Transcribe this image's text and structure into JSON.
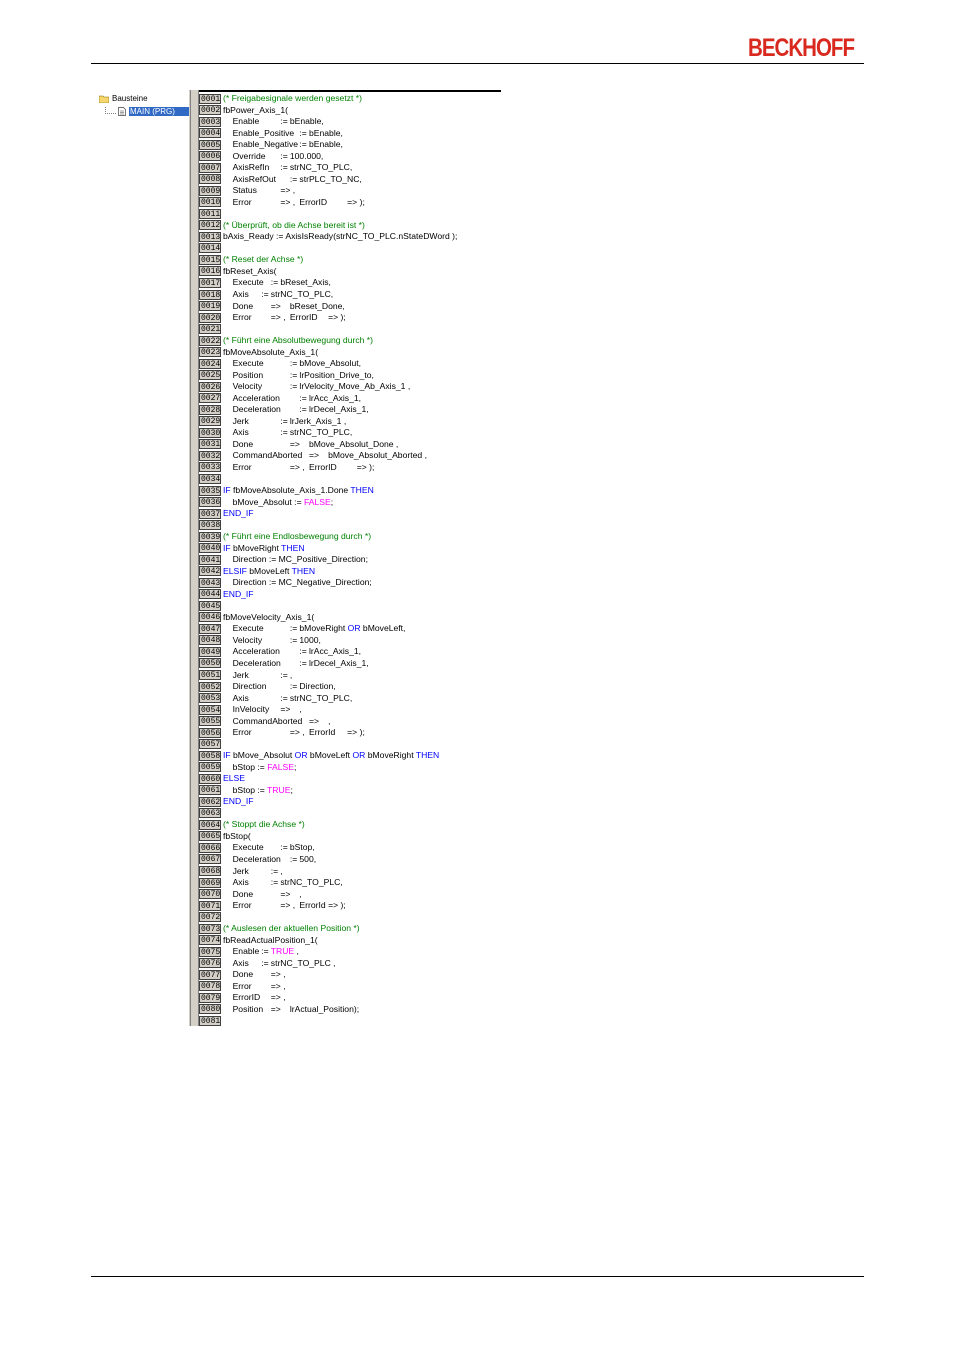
{
  "brand": {
    "logo_text": "BECKHOFF",
    "logo_color": "#d9281e"
  },
  "tree": {
    "root_label": "Bausteine",
    "child_label": "MAIN (PRG)"
  },
  "colors": {
    "comment": "#008000",
    "keyword": "#0000ff",
    "literal": "#ff00ff",
    "selection": "#316ac5"
  },
  "code_lines": [
    {
      "num": "0001",
      "tokens": [
        {
          "t": "comment",
          "s": "(* Freigabesignale werden gesetzt *)"
        }
      ]
    },
    {
      "num": "0002",
      "tokens": [
        {
          "t": "text",
          "s": "fbPower_Axis_1("
        }
      ]
    },
    {
      "num": "0003",
      "tokens": [
        {
          "t": "text",
          "s": "\tEnable\t\t\t:=\tbEnable,"
        }
      ]
    },
    {
      "num": "0004",
      "tokens": [
        {
          "t": "text",
          "s": "\tEnable_Positive\t:=\tbEnable,"
        }
      ]
    },
    {
      "num": "0005",
      "tokens": [
        {
          "t": "text",
          "s": "\tEnable_Negative\t:=\tbEnable,"
        }
      ]
    },
    {
      "num": "0006",
      "tokens": [
        {
          "t": "text",
          "s": "\tOverride\t\t:=\t100.000,"
        }
      ]
    },
    {
      "num": "0007",
      "tokens": [
        {
          "t": "text",
          "s": "\tAxisRefIn\t\t:=\tstrNC_TO_PLC,"
        }
      ]
    },
    {
      "num": "0008",
      "tokens": [
        {
          "t": "text",
          "s": "\tAxisRefOut\t\t:=\tstrPLC_TO_NC,"
        }
      ]
    },
    {
      "num": "0009",
      "tokens": [
        {
          "t": "text",
          "s": "\tStatus\t\t\t=> ,"
        }
      ]
    },
    {
      "num": "0010",
      "tokens": [
        {
          "t": "text",
          "s": "\tError\t\t\t=> ,\tErrorID\t\t=> );"
        }
      ]
    },
    {
      "num": "0011",
      "tokens": []
    },
    {
      "num": "0012",
      "tokens": [
        {
          "t": "comment",
          "s": "(* Überprüft, ob die Achse bereit ist *)"
        }
      ]
    },
    {
      "num": "0013",
      "tokens": [
        {
          "t": "text",
          "s": "bAxis_Ready := AxisIsReady(strNC_TO_PLC.nStateDWord );"
        }
      ]
    },
    {
      "num": "0014",
      "tokens": []
    },
    {
      "num": "0015",
      "tokens": [
        {
          "t": "comment",
          "s": "(* Reset der Achse *)"
        }
      ]
    },
    {
      "num": "0016",
      "tokens": [
        {
          "t": "text",
          "s": "fbReset_Axis("
        }
      ]
    },
    {
      "num": "0017",
      "tokens": [
        {
          "t": "text",
          "s": "\tExecute\t:=\tbReset_Axis,"
        }
      ]
    },
    {
      "num": "0018",
      "tokens": [
        {
          "t": "text",
          "s": "\tAxis\t\t:=\tstrNC_TO_PLC,"
        }
      ]
    },
    {
      "num": "0019",
      "tokens": [
        {
          "t": "text",
          "s": "\tDone\t\t=>\tbReset_Done,"
        }
      ]
    },
    {
      "num": "0020",
      "tokens": [
        {
          "t": "text",
          "s": "\tError\t\t=> ,\tErrorID\t=> );"
        }
      ]
    },
    {
      "num": "0021",
      "tokens": []
    },
    {
      "num": "0022",
      "tokens": [
        {
          "t": "comment",
          "s": "(* Führt eine Absolutbewegung durch *)"
        }
      ]
    },
    {
      "num": "0023",
      "tokens": [
        {
          "t": "text",
          "s": "fbMoveAbsolute_Axis_1("
        }
      ]
    },
    {
      "num": "0024",
      "tokens": [
        {
          "t": "text",
          "s": "\tExecute\t\t\t:=\tbMove_Absolut,"
        }
      ]
    },
    {
      "num": "0025",
      "tokens": [
        {
          "t": "text",
          "s": "\tPosition\t\t\t:=\tlrPosition_Drive_to,"
        }
      ]
    },
    {
      "num": "0026",
      "tokens": [
        {
          "t": "text",
          "s": "\tVelocity\t\t\t:=\tlrVelocity_Move_Ab_Axis_1 ,"
        }
      ]
    },
    {
      "num": "0027",
      "tokens": [
        {
          "t": "text",
          "s": "\tAcceleration\t\t:=\tlrAcc_Axis_1,"
        }
      ]
    },
    {
      "num": "0028",
      "tokens": [
        {
          "t": "text",
          "s": "\tDeceleration\t\t:=\tlrDecel_Axis_1,"
        }
      ]
    },
    {
      "num": "0029",
      "tokens": [
        {
          "t": "text",
          "s": "\tJerk\t\t\t\t:=\tlrJerk_Axis_1 ,"
        }
      ]
    },
    {
      "num": "0030",
      "tokens": [
        {
          "t": "text",
          "s": "\tAxis\t\t\t\t:=\tstrNC_TO_PLC,"
        }
      ]
    },
    {
      "num": "0031",
      "tokens": [
        {
          "t": "text",
          "s": "\tDone\t\t\t\t=>\tbMove_Absolut_Done ,"
        }
      ]
    },
    {
      "num": "0032",
      "tokens": [
        {
          "t": "text",
          "s": "\tCommandAborted\t=>\tbMove_Absolut_Aborted ,"
        }
      ]
    },
    {
      "num": "0033",
      "tokens": [
        {
          "t": "text",
          "s": "\tError\t\t\t\t=> ,\tErrorID\t\t=> );"
        }
      ]
    },
    {
      "num": "0034",
      "tokens": []
    },
    {
      "num": "0035",
      "tokens": [
        {
          "t": "keyword",
          "s": "IF "
        },
        {
          "t": "text",
          "s": "fbMoveAbsolute_Axis_1.Done "
        },
        {
          "t": "keyword",
          "s": "THEN"
        }
      ]
    },
    {
      "num": "0036",
      "tokens": [
        {
          "t": "text",
          "s": "\tbMove_Absolut := "
        },
        {
          "t": "literal",
          "s": "FALSE"
        },
        {
          "t": "text",
          "s": ";"
        }
      ]
    },
    {
      "num": "0037",
      "tokens": [
        {
          "t": "keyword",
          "s": "END_IF"
        }
      ]
    },
    {
      "num": "0038",
      "tokens": []
    },
    {
      "num": "0039",
      "tokens": [
        {
          "t": "comment",
          "s": "(* Führt eine Endlosbewegung durch *)"
        }
      ]
    },
    {
      "num": "0040",
      "tokens": [
        {
          "t": "keyword",
          "s": "IF "
        },
        {
          "t": "text",
          "s": "bMoveRight "
        },
        {
          "t": "keyword",
          "s": "THEN"
        }
      ]
    },
    {
      "num": "0041",
      "tokens": [
        {
          "t": "text",
          "s": "\tDirection := MC_Positive_Direction;"
        }
      ]
    },
    {
      "num": "0042",
      "tokens": [
        {
          "t": "keyword",
          "s": "ELSIF "
        },
        {
          "t": "text",
          "s": "bMoveLeft "
        },
        {
          "t": "keyword",
          "s": "THEN"
        }
      ]
    },
    {
      "num": "0043",
      "tokens": [
        {
          "t": "text",
          "s": "\tDirection := MC_Negative_Direction;"
        }
      ]
    },
    {
      "num": "0044",
      "tokens": [
        {
          "t": "keyword",
          "s": "END_IF"
        }
      ]
    },
    {
      "num": "0045",
      "tokens": []
    },
    {
      "num": "0046",
      "tokens": [
        {
          "t": "text",
          "s": "fbMoveVelocity_Axis_1("
        }
      ]
    },
    {
      "num": "0047",
      "tokens": [
        {
          "t": "text",
          "s": "\tExecute\t\t\t:=\tbMoveRight "
        },
        {
          "t": "keyword",
          "s": "OR"
        },
        {
          "t": "text",
          "s": " bMoveLeft,"
        }
      ]
    },
    {
      "num": "0048",
      "tokens": [
        {
          "t": "text",
          "s": "\tVelocity\t\t\t:=\t1000,"
        }
      ]
    },
    {
      "num": "0049",
      "tokens": [
        {
          "t": "text",
          "s": "\tAcceleration\t\t:=\tlrAcc_Axis_1,"
        }
      ]
    },
    {
      "num": "0050",
      "tokens": [
        {
          "t": "text",
          "s": "\tDeceleration\t\t:=\tlrDecel_Axis_1,"
        }
      ]
    },
    {
      "num": "0051",
      "tokens": [
        {
          "t": "text",
          "s": "\tJerk\t\t\t\t:=\t,"
        }
      ]
    },
    {
      "num": "0052",
      "tokens": [
        {
          "t": "text",
          "s": "\tDirection\t\t\t:=\tDirection,"
        }
      ]
    },
    {
      "num": "0053",
      "tokens": [
        {
          "t": "text",
          "s": "\tAxis\t\t\t\t:=\tstrNC_TO_PLC,"
        }
      ]
    },
    {
      "num": "0054",
      "tokens": [
        {
          "t": "text",
          "s": "\tInVelocity\t\t=>\t,"
        }
      ]
    },
    {
      "num": "0055",
      "tokens": [
        {
          "t": "text",
          "s": "\tCommandAborted\t=>\t,"
        }
      ]
    },
    {
      "num": "0056",
      "tokens": [
        {
          "t": "text",
          "s": "\tError\t\t\t\t=> ,\tErrorId\t\t=> );"
        }
      ]
    },
    {
      "num": "0057",
      "tokens": []
    },
    {
      "num": "0058",
      "tokens": [
        {
          "t": "keyword",
          "s": "IF "
        },
        {
          "t": "text",
          "s": "bMove_Absolut "
        },
        {
          "t": "keyword",
          "s": "OR"
        },
        {
          "t": "text",
          "s": " bMoveLeft "
        },
        {
          "t": "keyword",
          "s": "OR"
        },
        {
          "t": "text",
          "s": " bMoveRight "
        },
        {
          "t": "keyword",
          "s": "THEN"
        }
      ]
    },
    {
      "num": "0059",
      "tokens": [
        {
          "t": "text",
          "s": "\tbStop := "
        },
        {
          "t": "literal",
          "s": "FALSE"
        },
        {
          "t": "text",
          "s": ";"
        }
      ]
    },
    {
      "num": "0060",
      "tokens": [
        {
          "t": "keyword",
          "s": "ELSE"
        }
      ]
    },
    {
      "num": "0061",
      "tokens": [
        {
          "t": "text",
          "s": "\tbStop := "
        },
        {
          "t": "literal",
          "s": "TRUE"
        },
        {
          "t": "text",
          "s": ";"
        }
      ]
    },
    {
      "num": "0062",
      "tokens": [
        {
          "t": "keyword",
          "s": "END_IF"
        }
      ]
    },
    {
      "num": "0063",
      "tokens": []
    },
    {
      "num": "0064",
      "tokens": [
        {
          "t": "comment",
          "s": "(* Stoppt die Achse *)"
        }
      ]
    },
    {
      "num": "0065",
      "tokens": [
        {
          "t": "text",
          "s": "fbStop("
        }
      ]
    },
    {
      "num": "0066",
      "tokens": [
        {
          "t": "text",
          "s": "\tExecute\t\t:=\tbStop,"
        }
      ]
    },
    {
      "num": "0067",
      "tokens": [
        {
          "t": "text",
          "s": "\tDeceleration\t:=\t500,"
        }
      ]
    },
    {
      "num": "0068",
      "tokens": [
        {
          "t": "text",
          "s": "\tJerk\t\t\t:=\t,"
        }
      ]
    },
    {
      "num": "0069",
      "tokens": [
        {
          "t": "text",
          "s": "\tAxis\t\t\t:=\tstrNC_TO_PLC,"
        }
      ]
    },
    {
      "num": "0070",
      "tokens": [
        {
          "t": "text",
          "s": "\tDone\t\t\t=>\t,"
        }
      ]
    },
    {
      "num": "0071",
      "tokens": [
        {
          "t": "text",
          "s": "\tError\t\t\t=> ,\tErrorId\t=> );"
        }
      ]
    },
    {
      "num": "0072",
      "tokens": []
    },
    {
      "num": "0073",
      "tokens": [
        {
          "t": "comment",
          "s": "(* Auslesen der aktuellen Position *)"
        }
      ]
    },
    {
      "num": "0074",
      "tokens": [
        {
          "t": "text",
          "s": "fbReadActualPosition_1("
        }
      ]
    },
    {
      "num": "0075",
      "tokens": [
        {
          "t": "text",
          "s": "\tEnable\t:=\t"
        },
        {
          "t": "literal",
          "s": "TRUE"
        },
        {
          "t": "text",
          "s": " ,"
        }
      ]
    },
    {
      "num": "0076",
      "tokens": [
        {
          "t": "text",
          "s": "\tAxis\t\t:=\tstrNC_TO_PLC ,"
        }
      ]
    },
    {
      "num": "0077",
      "tokens": [
        {
          "t": "text",
          "s": "\tDone\t\t=> ,"
        }
      ]
    },
    {
      "num": "0078",
      "tokens": [
        {
          "t": "text",
          "s": "\tError\t\t=> ,"
        }
      ]
    },
    {
      "num": "0079",
      "tokens": [
        {
          "t": "text",
          "s": "\tErrorID\t=> ,"
        }
      ]
    },
    {
      "num": "0080",
      "tokens": [
        {
          "t": "text",
          "s": "\tPosition\t=>\tlrActual_Position);"
        }
      ]
    },
    {
      "num": "0081",
      "tokens": []
    }
  ]
}
